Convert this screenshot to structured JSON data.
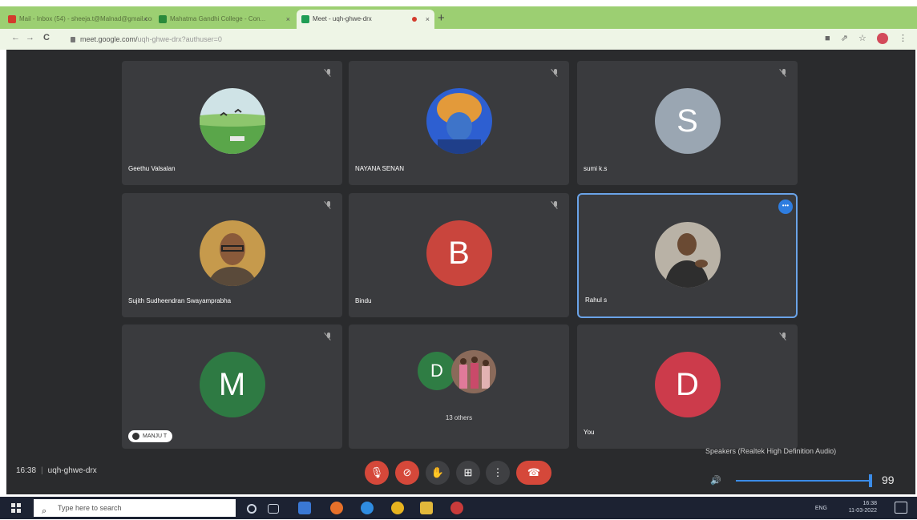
{
  "browser": {
    "tabs": [
      {
        "label": "Mail - Inbox (54) - sheeja.t@Malnad@gmail.com",
        "favicon_color": "#d33b2c",
        "active": false
      },
      {
        "label": "Mahatma Gandhi College - Con...",
        "favicon_color": "#2a8a3b",
        "active": false
      },
      {
        "label": "Meet - uqh-ghwe-drx",
        "favicon_color": "#1f9d55",
        "active": true
      }
    ],
    "url_host": "meet.google.com/",
    "url_path": "uqh-ghwe-drx?authuser=0",
    "nav": {
      "back": "←",
      "forward": "→",
      "reload": "C"
    },
    "toolbar_icons": [
      "■",
      "⇗",
      "☆"
    ],
    "menu": "⋮"
  },
  "participants": [
    {
      "name": "Geethu Valsalan",
      "avatar_type": "photo",
      "photo": "landscape"
    },
    {
      "name": "NAYANA SENAN",
      "avatar_type": "photo",
      "photo": "orange-cap"
    },
    {
      "name": "sumi k.s",
      "avatar_type": "letter",
      "letter": "S",
      "color": "#9aa6b2"
    },
    {
      "name": "Sujith Sudheendran Swayamprabha",
      "avatar_type": "photo",
      "photo": "man-glasses"
    },
    {
      "name": "Bindu",
      "avatar_type": "letter",
      "letter": "B",
      "color": "#c9453d"
    },
    {
      "name": "Rahul s",
      "avatar_type": "photo",
      "photo": "man-hands",
      "pinned": true
    },
    {
      "name": "MANJU T",
      "avatar_type": "letter",
      "letter": "M",
      "color": "#2e7a43",
      "chip": true
    },
    {
      "others_label": "13 others",
      "letter": "D",
      "avatar_type": "group"
    },
    {
      "name": "You",
      "avatar_type": "letter",
      "letter": "D",
      "color": "#cc3b4b"
    }
  ],
  "meeting": {
    "time": "16:38",
    "code": "uqh-ghwe-drx"
  },
  "controls": {
    "mic": "🎙",
    "camera": "⊘",
    "raise_hand": "✋",
    "present": "⊞",
    "more": "⋮",
    "hangup": "☎",
    "mic_color": "#d5483a",
    "hangup_color": "#d5483a"
  },
  "volume": {
    "device": "Speakers (Realtek High Definition Audio)",
    "level": 99,
    "icon": "🔊"
  },
  "taskbar": {
    "search_placeholder": "Type here to search",
    "tray_lang": "ENG",
    "tray_time": "16:38",
    "tray_date": "11-03-2022"
  }
}
